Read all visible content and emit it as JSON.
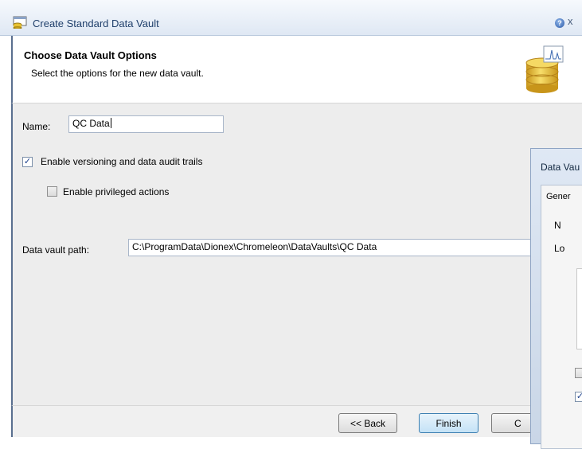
{
  "window": {
    "title": "Create Standard Data Vault",
    "help_glyph": "?",
    "close_glyph": "x"
  },
  "header": {
    "title": "Choose Data Vault Options",
    "subtitle": "Select the options for the new data vault."
  },
  "form": {
    "name_label": "Name:",
    "name_value": "QC Data",
    "versioning_label": "Enable versioning and data audit trails",
    "versioning_checked": true,
    "privileged_label": "Enable privileged actions",
    "privileged_checked": false,
    "path_label": "Data vault path:",
    "path_value": "C:\\ProgramData\\Dionex\\Chromeleon\\DataVaults\\QC Data"
  },
  "footer": {
    "back_label": "<< Back",
    "finish_label": "Finish",
    "cancel_label": "C"
  },
  "second_window": {
    "title": "Data Vau",
    "tab_label": "Gener",
    "line1": "N",
    "line2": "Lo",
    "check_glyph": "✓"
  },
  "icons": {
    "app_icon": "database-window-icon",
    "header_icon": "database-chromatogram-icon"
  },
  "colors": {
    "title_text": "#1f3f6b",
    "content_bg": "#ededed",
    "default_button": "#c4e2f6",
    "database_gold": "#e8c232"
  }
}
